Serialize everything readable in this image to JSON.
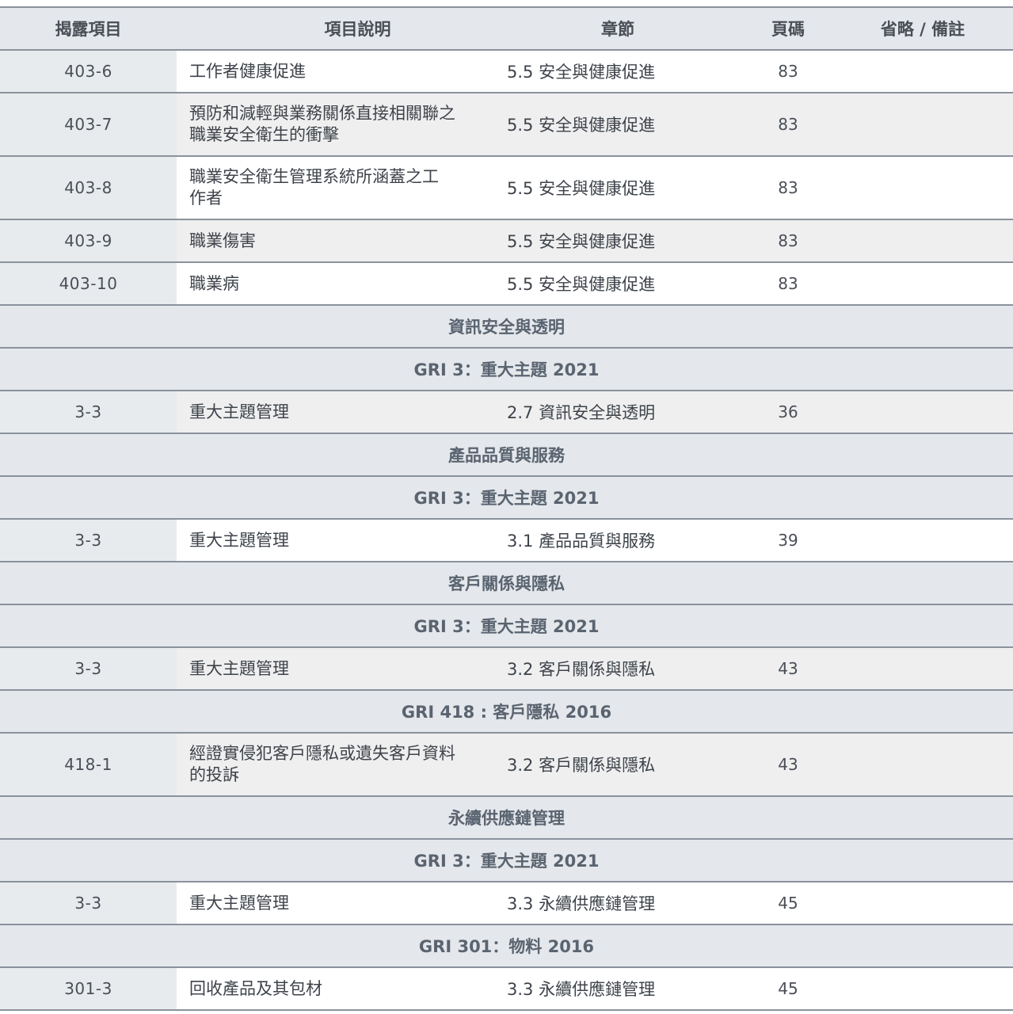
{
  "headers": {
    "code": "揭露項目",
    "desc": "項目說明",
    "chapter": "章節",
    "page": "頁碼",
    "note": "省略 / 備註"
  },
  "rows": {
    "r403_6": {
      "code": "403-6",
      "desc": "工作者健康促進",
      "chapter": "5.5 安全與健康促進",
      "page": "83"
    },
    "r403_7": {
      "code": "403-7",
      "desc_line1": "預防和減輕與業務關係直接相關聯之",
      "desc_line2": "職業安全衛生的衝擊",
      "chapter": "5.5 安全與健康促進",
      "page": "83"
    },
    "r403_8": {
      "code": "403-8",
      "desc_line1": "職業安全衛生管理系統所涵蓋之工",
      "desc_line2": "作者",
      "chapter": "5.5 安全與健康促進",
      "page": "83"
    },
    "r403_9": {
      "code": "403-9",
      "desc": "職業傷害",
      "chapter": "5.5 安全與健康促進",
      "page": "83"
    },
    "r403_10": {
      "code": "403-10",
      "desc": "職業病",
      "chapter": "5.5 安全與健康促進",
      "page": "83"
    },
    "infosec_3_3": {
      "code": "3-3",
      "desc": "重大主題管理",
      "chapter": "2.7 資訊安全與透明",
      "page": "36"
    },
    "quality_3_3": {
      "code": "3-3",
      "desc": "重大主題管理",
      "chapter": "3.1 產品品質與服務",
      "page": "39"
    },
    "privacy_3_3": {
      "code": "3-3",
      "desc": "重大主題管理",
      "chapter": "3.2 客戶關係與隱私",
      "page": "43"
    },
    "r418_1": {
      "code": "418-1",
      "desc_line1": "經證實侵犯客戶隱私或遺失客戶資料",
      "desc_line2": "的投訴",
      "chapter": "3.2 客戶關係與隱私",
      "page": "43"
    },
    "supply_3_3": {
      "code": "3-3",
      "desc": "重大主題管理",
      "chapter": "3.3 永續供應鏈管理",
      "page": "45"
    },
    "r301_3": {
      "code": "301-3",
      "desc": "回收產品及其包材",
      "chapter": "3.3 永續供應鏈管理",
      "page": "45"
    }
  },
  "sections": {
    "infosec": "資訊安全與透明",
    "gri3_a": "GRI 3：重大主題 2021",
    "quality": "產品品質與服務",
    "gri3_b": "GRI 3：重大主題 2021",
    "privacy": "客戶關係與隱私",
    "gri3_c": "GRI 3：重大主題 2021",
    "gri418": "GRI 418 : 客戶隱私 2016",
    "supply": "永續供應鏈管理",
    "gri3_d": "GRI 3：重大主題 2021",
    "gri301": "GRI 301：物料 2016"
  }
}
